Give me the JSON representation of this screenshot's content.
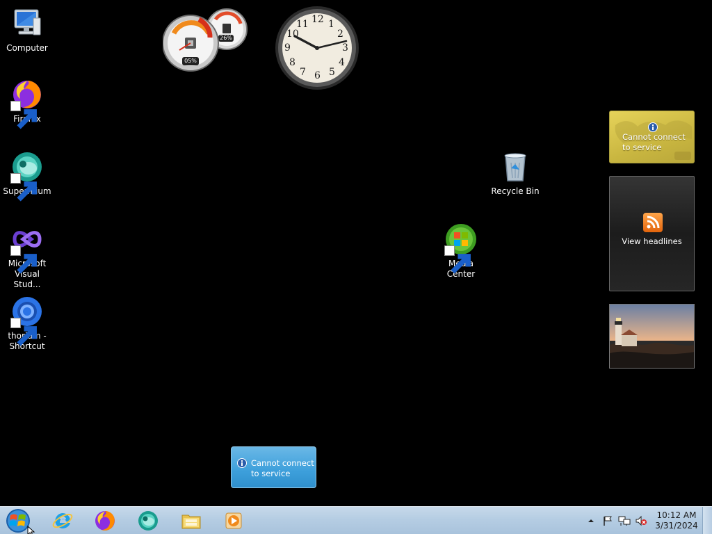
{
  "desktop_icons": [
    {
      "label": "Computer"
    },
    {
      "label": "Firefox"
    },
    {
      "label": "Supermium"
    },
    {
      "label": "Microsoft Visual Stud..."
    },
    {
      "label": "thorium - Shortcut"
    },
    {
      "label": "Recycle Bin"
    },
    {
      "label": "Media Center"
    }
  ],
  "gadgets": {
    "cpu_meter": {
      "cpu": "05%",
      "memory": "26%"
    },
    "clock": {
      "numbers": [
        "12",
        "1",
        "2",
        "3",
        "4",
        "5",
        "6",
        "7",
        "8",
        "9",
        "10",
        "11"
      ]
    },
    "weather": {
      "message": "Cannot connect to service"
    },
    "feeds": {
      "label": "View headlines"
    },
    "toast": {
      "message": "Cannot connect to service"
    }
  },
  "taskbar": {
    "pinned": [
      "start-orb-icon",
      "internet-explorer-icon",
      "firefox-icon",
      "supermium-icon",
      "windows-explorer-icon",
      "media-player-icon"
    ],
    "clock": {
      "time": "10:12 AM",
      "date": "3/31/2024"
    },
    "tray_icons": [
      "show-hidden-icons",
      "action-center-flag-icon",
      "network-icon",
      "volume-muted-icon"
    ]
  }
}
